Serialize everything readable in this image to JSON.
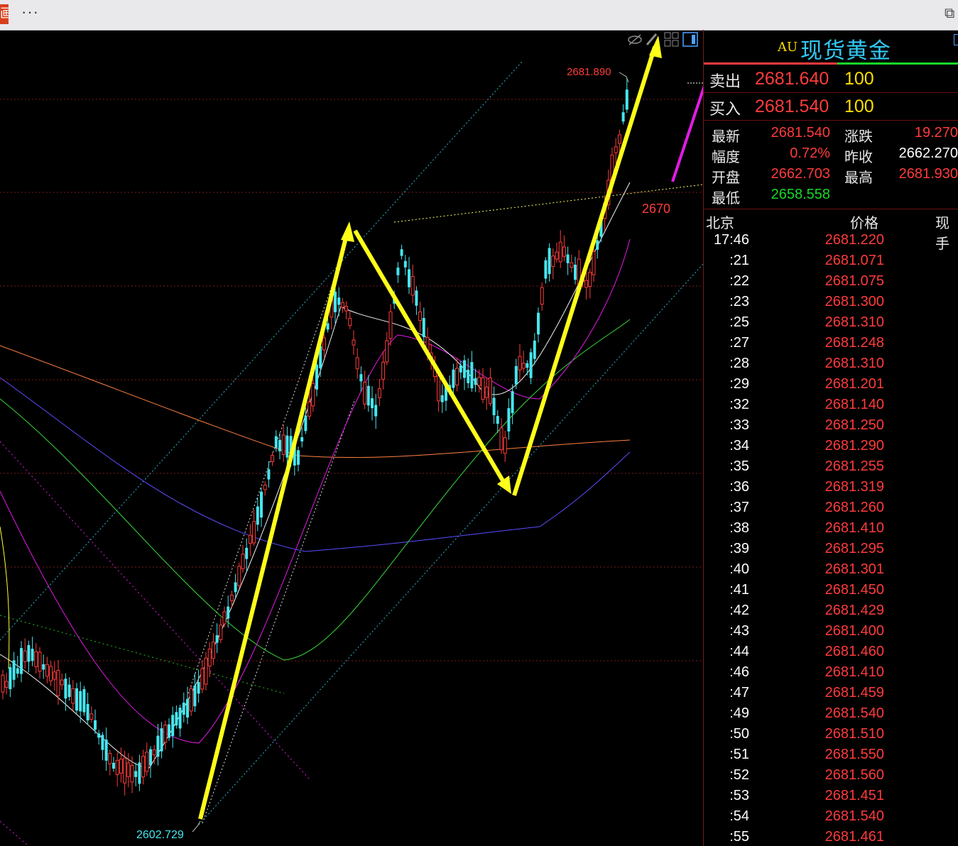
{
  "window": {
    "app_icon_glyph": "画",
    "more_menu": "···"
  },
  "chart": {
    "high_label": "2681.890",
    "low_label": "2602.729",
    "level_label": "2670",
    "toolbar_icons": [
      "eye-hide-icon",
      "pencil-icon",
      "grid-layout-icon",
      "panel-toggle-icon"
    ],
    "colors": {
      "up": "#ff3b3b",
      "down": "#46e6ee",
      "arrow": "#ffff1a",
      "magenta_arrow": "#e21be6",
      "grid": "#7a1a1a"
    }
  },
  "panel": {
    "symbol_prefix": "AU",
    "instrument_name": "现货黄金",
    "sell": {
      "label": "卖出",
      "price": "2681.640",
      "volume": "100"
    },
    "buy": {
      "label": "买入",
      "price": "2681.540",
      "volume": "100"
    },
    "stats": {
      "latest_label": "最新",
      "latest": "2681.540",
      "change_label": "涨跌",
      "change": "19.270",
      "range_label": "幅度",
      "range": "0.72%",
      "prev_close_label": "昨收",
      "prev_close": "2662.270",
      "open_label": "开盘",
      "open": "2662.703",
      "high_label": "最高",
      "high": "2681.930",
      "low_label": "最低",
      "low": "2658.558"
    },
    "tick_header": {
      "time": "北京",
      "price": "价格",
      "volume": "现手"
    },
    "ticks": [
      {
        "time": "17:46",
        "price": "2681.220"
      },
      {
        "time": ":21",
        "price": "2681.071"
      },
      {
        "time": ":22",
        "price": "2681.075"
      },
      {
        "time": ":23",
        "price": "2681.300"
      },
      {
        "time": ":25",
        "price": "2681.310"
      },
      {
        "time": ":27",
        "price": "2681.248"
      },
      {
        "time": ":28",
        "price": "2681.310"
      },
      {
        "time": ":29",
        "price": "2681.201"
      },
      {
        "time": ":32",
        "price": "2681.140"
      },
      {
        "time": ":33",
        "price": "2681.250"
      },
      {
        "time": ":34",
        "price": "2681.290"
      },
      {
        "time": ":35",
        "price": "2681.255"
      },
      {
        "time": ":36",
        "price": "2681.319"
      },
      {
        "time": ":37",
        "price": "2681.260"
      },
      {
        "time": ":38",
        "price": "2681.410"
      },
      {
        "time": ":39",
        "price": "2681.295"
      },
      {
        "time": ":40",
        "price": "2681.301"
      },
      {
        "time": ":41",
        "price": "2681.450"
      },
      {
        "time": ":42",
        "price": "2681.429"
      },
      {
        "time": ":43",
        "price": "2681.400"
      },
      {
        "time": ":44",
        "price": "2681.460"
      },
      {
        "time": ":46",
        "price": "2681.410"
      },
      {
        "time": ":47",
        "price": "2681.459"
      },
      {
        "time": ":49",
        "price": "2681.540"
      },
      {
        "time": ":50",
        "price": "2681.510"
      },
      {
        "time": ":51",
        "price": "2681.550"
      },
      {
        "time": ":52",
        "price": "2681.560"
      },
      {
        "time": ":53",
        "price": "2681.451"
      },
      {
        "time": ":54",
        "price": "2681.540"
      },
      {
        "time": ":55",
        "price": "2681.461"
      }
    ]
  }
}
